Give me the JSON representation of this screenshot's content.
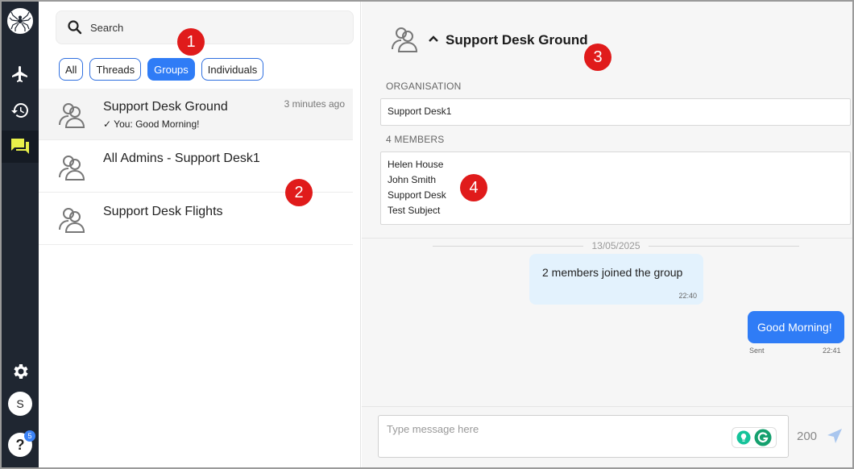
{
  "search": {
    "placeholder": "Search"
  },
  "filters": [
    {
      "label": "All",
      "active": false
    },
    {
      "label": "Threads",
      "active": false
    },
    {
      "label": "Groups",
      "active": true
    },
    {
      "label": "Individuals",
      "active": false
    }
  ],
  "conversations": [
    {
      "title": "Support Desk Ground",
      "time": "3 minutes ago",
      "last_message": "✓ You: Good Morning!",
      "active": true
    },
    {
      "title": "All Admins - Support Desk1",
      "time": "",
      "last_message": "",
      "active": false
    },
    {
      "title": "Support Desk Flights",
      "time": "",
      "last_message": "",
      "active": false
    }
  ],
  "rail": {
    "avatar_initial": "S",
    "help_label": "?",
    "help_badge": "5",
    "icons": [
      "spider-logo-icon",
      "airplane-icon",
      "history-icon",
      "chat-icon",
      "gear-icon"
    ]
  },
  "chat": {
    "title": "Support Desk Ground",
    "organisation_label": "ORGANISATION",
    "organisation_value": "Support Desk1",
    "members_label": "4 MEMBERS",
    "members": [
      "Helen House",
      "John Smith",
      "Support Desk",
      "Test Subject"
    ],
    "date_divider": "13/05/2025",
    "messages": [
      {
        "type": "system",
        "text": "2 members joined the group",
        "time": "22:40"
      },
      {
        "type": "outgoing",
        "text": "Good Morning!",
        "status": "Sent",
        "time": "22:41"
      }
    ],
    "composer": {
      "placeholder": "Type message here",
      "char_count": "200"
    }
  },
  "markers": [
    "1",
    "2",
    "3",
    "4"
  ],
  "colors": {
    "rail": "#1f2631",
    "accent": "#2f7cf6",
    "chat_icon_active": "#e8f04a",
    "marker": "#e01b1b"
  }
}
